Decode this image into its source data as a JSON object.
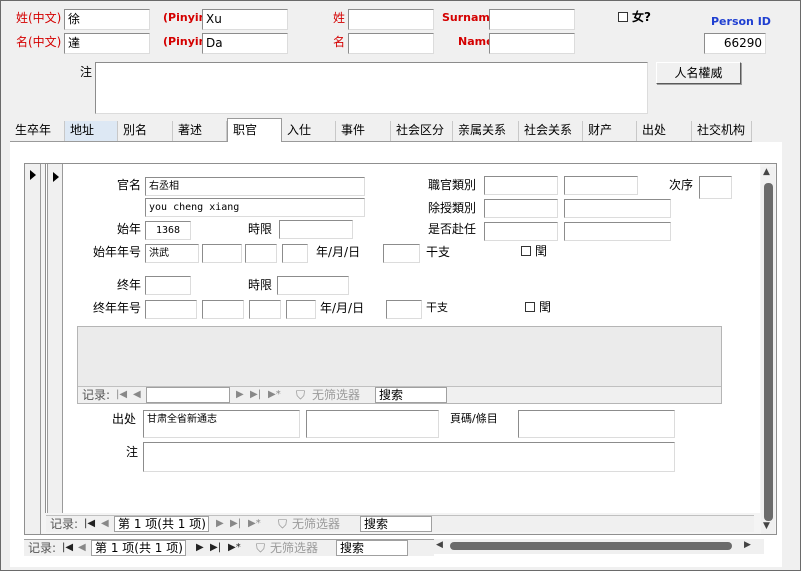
{
  "header": {
    "surname_zh_label": "姓(中文)",
    "given_zh_label": "名(中文)",
    "surname_zh_value": "徐",
    "given_zh_value": "達",
    "pinyin_label_1": "(Pinyin)",
    "pinyin_label_2": "(Pinyin)",
    "pinyin_surname_value": "Xu",
    "pinyin_given_value": "Da",
    "xing_label": "姓",
    "ming_label": "名",
    "xing_value": "",
    "ming_value": "",
    "surname_en_label": "Surname",
    "name_en_label": "Name",
    "surname_en_value": "",
    "name_en_value": "",
    "female_label": "女?",
    "person_id_label": "Person ID",
    "person_id_value": "66290",
    "note_label": "注",
    "note_value": "",
    "authority_button": "人名權威"
  },
  "tabs": [
    {
      "label": "生卒年"
    },
    {
      "label": "地址"
    },
    {
      "label": "別名"
    },
    {
      "label": "著述"
    },
    {
      "label": "职官"
    },
    {
      "label": "入仕"
    },
    {
      "label": "事件"
    },
    {
      "label": "社会区分"
    },
    {
      "label": "亲属关系"
    },
    {
      "label": "社会关系"
    },
    {
      "label": "财产"
    },
    {
      "label": "出处"
    },
    {
      "label": "社交机构"
    }
  ],
  "office": {
    "office_name_label": "官名",
    "office_name_value": "右丞相",
    "office_pinyin_value": "you cheng xiang",
    "office_type_label": "職官類別",
    "sequence_label": "次序",
    "appointment_type_label": "除授類別",
    "took_post_label": "是否赴任",
    "start_year_label": "始年",
    "start_year_value": "1368",
    "start_range_label": "時限",
    "start_nianhao_label": "始年年号",
    "start_nianhao_value": "洪武",
    "ymd_label_1": "年/月/日",
    "ganzhi_label_1": "干支",
    "leap_label_1": "閏",
    "end_year_label": "终年",
    "end_range_label": "時限",
    "end_nianhao_label": "终年年号",
    "ymd_label_2": "年/月/日",
    "ganzhi_label_2": "干支",
    "leap_label_2": "閏",
    "source_label": "出处",
    "source_value": "甘肃全省新通志",
    "page_label": "頁碼/條目",
    "note_label": "注",
    "note_value": ""
  },
  "inner_nav": {
    "record_label": "记录:",
    "no_filter": "无筛选器",
    "search": "搜索"
  },
  "mid_nav": {
    "record_label": "记录:",
    "position": "第 1 项(共 1 项)",
    "no_filter": "无筛选器",
    "search": "搜索"
  },
  "main_nav": {
    "record_label": "记录:",
    "position": "第 1 项(共 1 项)",
    "no_filter": "无筛选器",
    "search": "搜索"
  }
}
